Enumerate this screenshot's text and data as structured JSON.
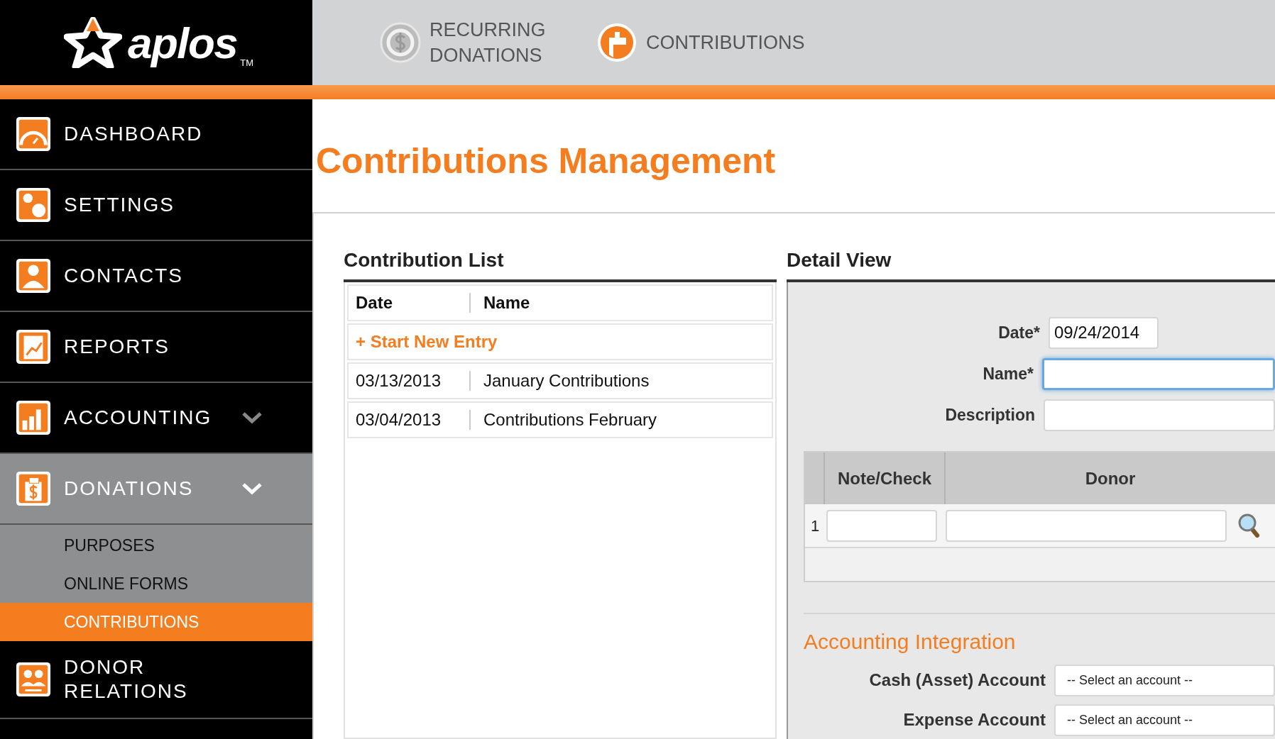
{
  "header": {
    "logo": "aplos",
    "trademark": "TM",
    "nav": [
      {
        "kind": "recurring",
        "label": "RECURRING DONATIONS"
      },
      {
        "kind": "contributions",
        "label": "CONTRIBUTIONS"
      }
    ]
  },
  "sidebar": {
    "items": [
      {
        "kind": "dashboard",
        "label": "DASHBOARD",
        "selected": false
      },
      {
        "kind": "settings",
        "label": "SETTINGS",
        "selected": false
      },
      {
        "kind": "contacts",
        "label": "CONTACTS",
        "selected": false
      },
      {
        "kind": "reports",
        "label": "REPORTS",
        "selected": false
      },
      {
        "kind": "accounting",
        "label": "ACCOUNTING",
        "selected": false,
        "expanded": false
      },
      {
        "kind": "donations",
        "label": "DONATIONS",
        "selected": true,
        "expanded": true,
        "children": [
          {
            "label": "PURPOSES",
            "selected": false
          },
          {
            "label": "ONLINE FORMS",
            "selected": false
          },
          {
            "label": "CONTRIBUTIONS",
            "selected": true
          }
        ]
      },
      {
        "kind": "donor-relations",
        "label": "DONOR RELATIONS",
        "selected": false
      }
    ]
  },
  "page_title": "Contributions Management",
  "contribution_list": {
    "title": "Contribution List",
    "columns": [
      "Date",
      "Name"
    ],
    "new_entry": "+ Start New Entry",
    "rows": [
      {
        "date": "03/13/2013",
        "name": "January Contributions"
      },
      {
        "date": "03/04/2013",
        "name": "Contributions February"
      }
    ]
  },
  "detail_view": {
    "title": "Detail View",
    "fields": [
      {
        "label": "Date*",
        "value": "09/24/2014",
        "focused": false,
        "kind": "short"
      },
      {
        "label": "Name*",
        "focused": true,
        "kind": "long"
      },
      {
        "label": "Description",
        "focused": false,
        "kind": "long"
      }
    ],
    "grid": {
      "columns": [
        "Note/Check",
        "Donor"
      ],
      "rows": [
        {
          "number": "1"
        }
      ]
    },
    "accounting": {
      "title": "Accounting Integration",
      "selects": [
        {
          "label": "Cash (Asset) Account",
          "value": "-- Select an account --"
        },
        {
          "label": "Expense Account",
          "value": "-- Select an account --"
        }
      ]
    }
  }
}
